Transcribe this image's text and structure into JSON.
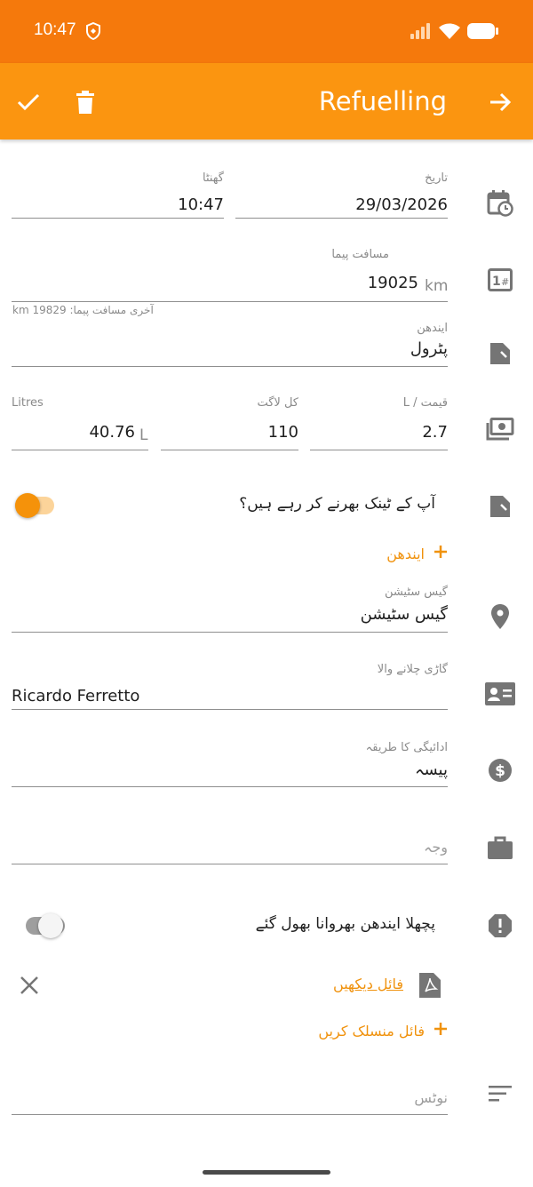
{
  "status_bar": {
    "time": "10:47"
  },
  "app_bar": {
    "title": "Refuelling"
  },
  "colors": {
    "status_bar": "#f5790c",
    "app_bar": "#fb9510",
    "accent": "#f0920d",
    "icon_grey": "#757575"
  },
  "form": {
    "time": {
      "label": "گھنٹا",
      "value": "10:47"
    },
    "date": {
      "label": "تاریخ",
      "value": "29/03/2026"
    },
    "odometer": {
      "label": "مسافت پیما",
      "value": "19025",
      "unit": "km",
      "helper": "آخری مسافت پیما: 19829 km"
    },
    "fuel": {
      "label": "ایندھن",
      "value": "پٹرول"
    },
    "litres": {
      "label": "Litres",
      "value": "40.76",
      "unit": "L"
    },
    "total_cost": {
      "label": "کل لاگت",
      "value": "110"
    },
    "price": {
      "label": "قیمت / L",
      "value": "2.7"
    },
    "full_tank": {
      "label": "آپ کے ٹینک بھرنے کر رہے ہیں؟",
      "checked": true
    },
    "add_fuel": {
      "label": "ایندھن"
    },
    "gas_station": {
      "label": "گیس سٹیشن",
      "value": "گیس سٹیشن"
    },
    "driver": {
      "label": "گاڑی چلانے والا",
      "value": "Ricardo Ferretto"
    },
    "payment": {
      "label": "ادائیگی کا طریقہ",
      "value": "پیسہ"
    },
    "reason": {
      "placeholder": "وجہ"
    },
    "missed_refuel": {
      "label": "پچھلا ایندھن بھروانا بھول گئے",
      "checked": false
    },
    "attachment": {
      "view_label": "فائل دیکھیں"
    },
    "attach": {
      "label": "فائل منسلک کریں"
    },
    "notes": {
      "placeholder": "نوٹس"
    }
  }
}
